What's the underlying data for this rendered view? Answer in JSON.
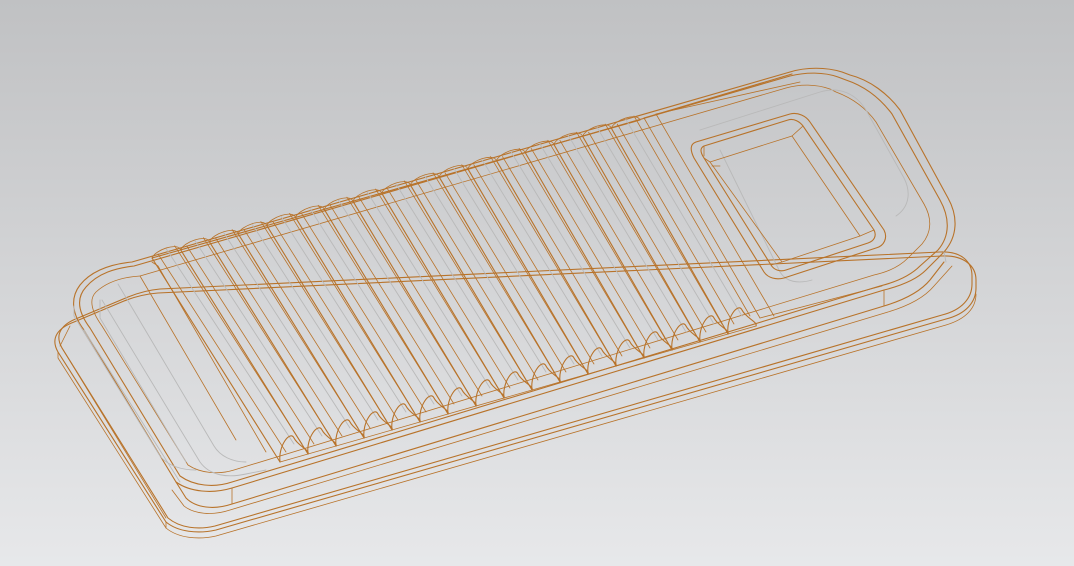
{
  "colors": {
    "background_top": "#c0c1c3",
    "background_bottom": "#e7e8ea",
    "edge": "#b8732a",
    "silhouette": "#b9b9b9"
  },
  "model": {
    "display_mode": "wireframe",
    "rib_count": 17
  }
}
